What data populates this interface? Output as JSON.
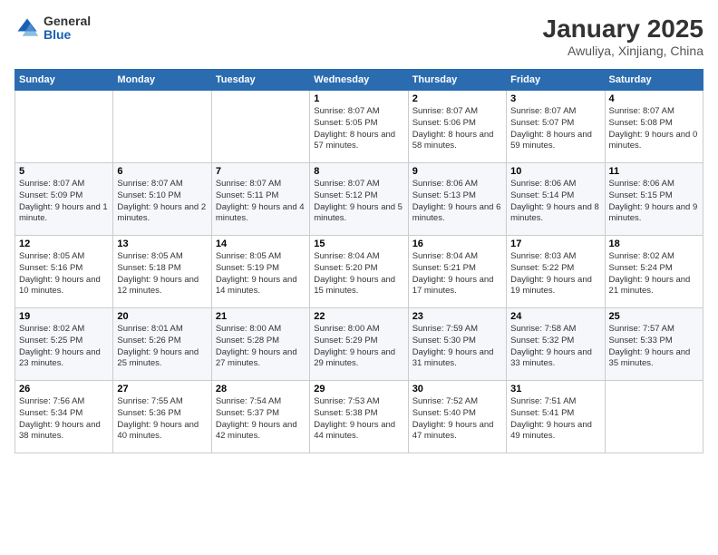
{
  "header": {
    "logo_general": "General",
    "logo_blue": "Blue",
    "month": "January 2025",
    "location": "Awuliya, Xinjiang, China"
  },
  "weekdays": [
    "Sunday",
    "Monday",
    "Tuesday",
    "Wednesday",
    "Thursday",
    "Friday",
    "Saturday"
  ],
  "weeks": [
    [
      {
        "day": "",
        "info": ""
      },
      {
        "day": "",
        "info": ""
      },
      {
        "day": "",
        "info": ""
      },
      {
        "day": "1",
        "info": "Sunrise: 8:07 AM\nSunset: 5:05 PM\nDaylight: 8 hours and 57 minutes."
      },
      {
        "day": "2",
        "info": "Sunrise: 8:07 AM\nSunset: 5:06 PM\nDaylight: 8 hours and 58 minutes."
      },
      {
        "day": "3",
        "info": "Sunrise: 8:07 AM\nSunset: 5:07 PM\nDaylight: 8 hours and 59 minutes."
      },
      {
        "day": "4",
        "info": "Sunrise: 8:07 AM\nSunset: 5:08 PM\nDaylight: 9 hours and 0 minutes."
      }
    ],
    [
      {
        "day": "5",
        "info": "Sunrise: 8:07 AM\nSunset: 5:09 PM\nDaylight: 9 hours and 1 minute."
      },
      {
        "day": "6",
        "info": "Sunrise: 8:07 AM\nSunset: 5:10 PM\nDaylight: 9 hours and 2 minutes."
      },
      {
        "day": "7",
        "info": "Sunrise: 8:07 AM\nSunset: 5:11 PM\nDaylight: 9 hours and 4 minutes."
      },
      {
        "day": "8",
        "info": "Sunrise: 8:07 AM\nSunset: 5:12 PM\nDaylight: 9 hours and 5 minutes."
      },
      {
        "day": "9",
        "info": "Sunrise: 8:06 AM\nSunset: 5:13 PM\nDaylight: 9 hours and 6 minutes."
      },
      {
        "day": "10",
        "info": "Sunrise: 8:06 AM\nSunset: 5:14 PM\nDaylight: 9 hours and 8 minutes."
      },
      {
        "day": "11",
        "info": "Sunrise: 8:06 AM\nSunset: 5:15 PM\nDaylight: 9 hours and 9 minutes."
      }
    ],
    [
      {
        "day": "12",
        "info": "Sunrise: 8:05 AM\nSunset: 5:16 PM\nDaylight: 9 hours and 10 minutes."
      },
      {
        "day": "13",
        "info": "Sunrise: 8:05 AM\nSunset: 5:18 PM\nDaylight: 9 hours and 12 minutes."
      },
      {
        "day": "14",
        "info": "Sunrise: 8:05 AM\nSunset: 5:19 PM\nDaylight: 9 hours and 14 minutes."
      },
      {
        "day": "15",
        "info": "Sunrise: 8:04 AM\nSunset: 5:20 PM\nDaylight: 9 hours and 15 minutes."
      },
      {
        "day": "16",
        "info": "Sunrise: 8:04 AM\nSunset: 5:21 PM\nDaylight: 9 hours and 17 minutes."
      },
      {
        "day": "17",
        "info": "Sunrise: 8:03 AM\nSunset: 5:22 PM\nDaylight: 9 hours and 19 minutes."
      },
      {
        "day": "18",
        "info": "Sunrise: 8:02 AM\nSunset: 5:24 PM\nDaylight: 9 hours and 21 minutes."
      }
    ],
    [
      {
        "day": "19",
        "info": "Sunrise: 8:02 AM\nSunset: 5:25 PM\nDaylight: 9 hours and 23 minutes."
      },
      {
        "day": "20",
        "info": "Sunrise: 8:01 AM\nSunset: 5:26 PM\nDaylight: 9 hours and 25 minutes."
      },
      {
        "day": "21",
        "info": "Sunrise: 8:00 AM\nSunset: 5:28 PM\nDaylight: 9 hours and 27 minutes."
      },
      {
        "day": "22",
        "info": "Sunrise: 8:00 AM\nSunset: 5:29 PM\nDaylight: 9 hours and 29 minutes."
      },
      {
        "day": "23",
        "info": "Sunrise: 7:59 AM\nSunset: 5:30 PM\nDaylight: 9 hours and 31 minutes."
      },
      {
        "day": "24",
        "info": "Sunrise: 7:58 AM\nSunset: 5:32 PM\nDaylight: 9 hours and 33 minutes."
      },
      {
        "day": "25",
        "info": "Sunrise: 7:57 AM\nSunset: 5:33 PM\nDaylight: 9 hours and 35 minutes."
      }
    ],
    [
      {
        "day": "26",
        "info": "Sunrise: 7:56 AM\nSunset: 5:34 PM\nDaylight: 9 hours and 38 minutes."
      },
      {
        "day": "27",
        "info": "Sunrise: 7:55 AM\nSunset: 5:36 PM\nDaylight: 9 hours and 40 minutes."
      },
      {
        "day": "28",
        "info": "Sunrise: 7:54 AM\nSunset: 5:37 PM\nDaylight: 9 hours and 42 minutes."
      },
      {
        "day": "29",
        "info": "Sunrise: 7:53 AM\nSunset: 5:38 PM\nDaylight: 9 hours and 44 minutes."
      },
      {
        "day": "30",
        "info": "Sunrise: 7:52 AM\nSunset: 5:40 PM\nDaylight: 9 hours and 47 minutes."
      },
      {
        "day": "31",
        "info": "Sunrise: 7:51 AM\nSunset: 5:41 PM\nDaylight: 9 hours and 49 minutes."
      },
      {
        "day": "",
        "info": ""
      }
    ]
  ]
}
